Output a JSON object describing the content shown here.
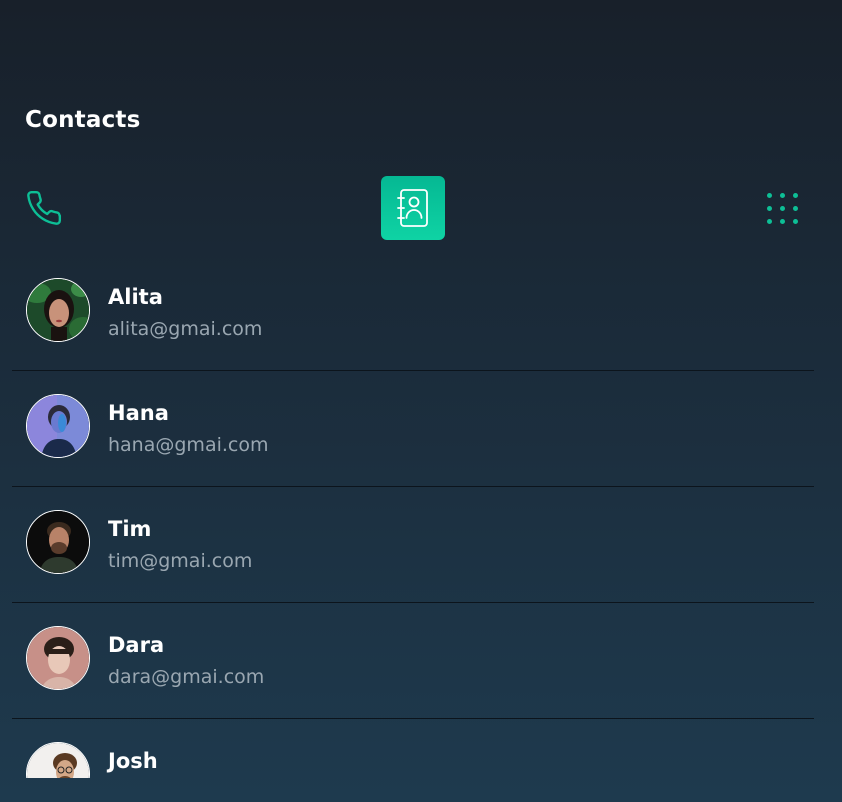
{
  "header": {
    "title": "Contacts"
  },
  "toolbar": {
    "items": [
      {
        "icon": "phone-icon"
      },
      {
        "icon": "contact-book-icon",
        "active": true
      },
      {
        "icon": "dialpad-grid-icon"
      }
    ],
    "accent": "#0dbf96"
  },
  "contacts": [
    {
      "name": "Alita",
      "email": "alita@gmai.com"
    },
    {
      "name": "Hana",
      "email": "hana@gmai.com"
    },
    {
      "name": "Tim",
      "email": "tim@gmai.com"
    },
    {
      "name": "Dara",
      "email": "dara@gmai.com"
    },
    {
      "name": "Josh",
      "email": ""
    }
  ]
}
